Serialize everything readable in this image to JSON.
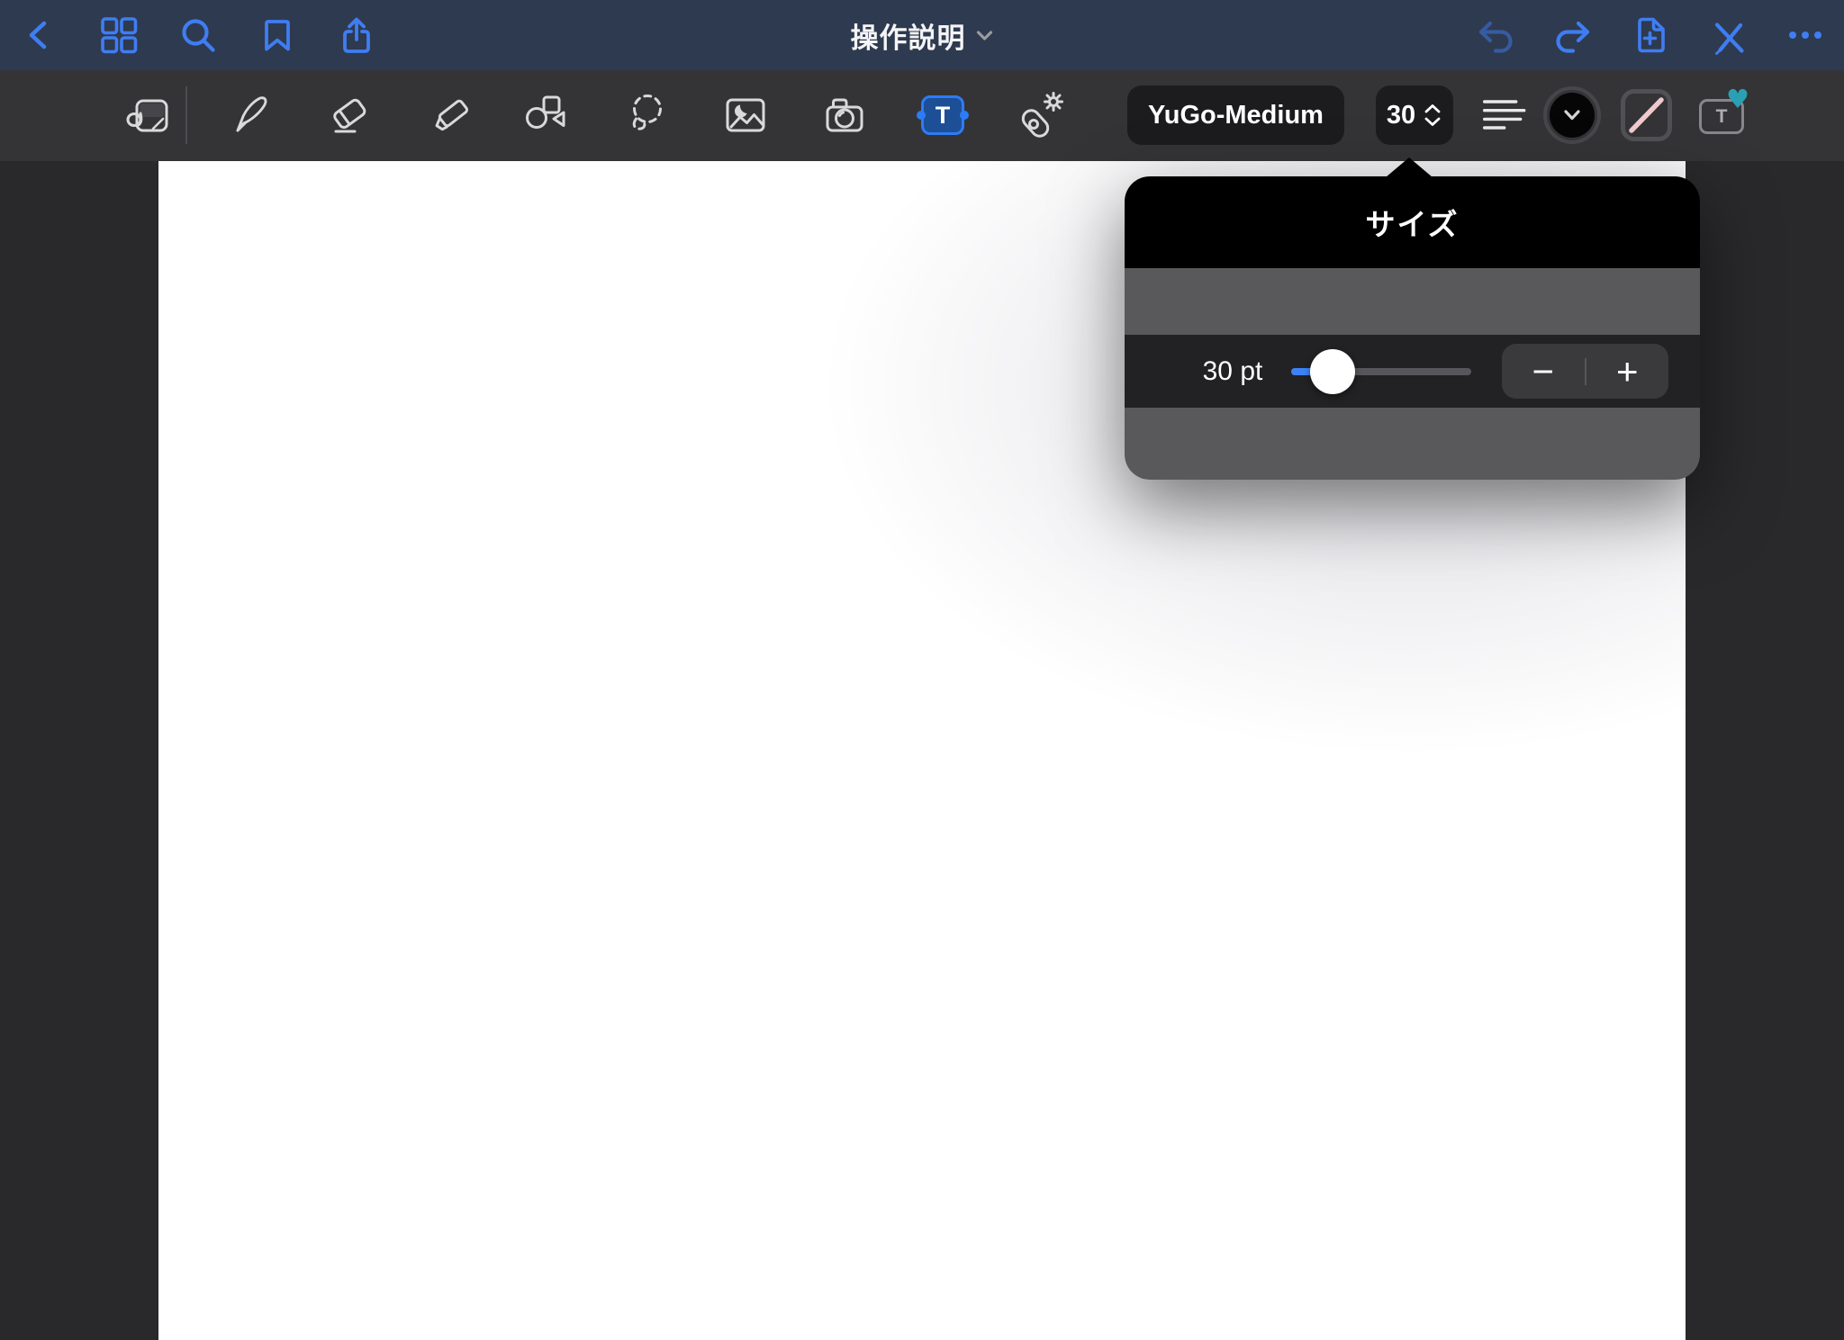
{
  "nav": {
    "title": "操作説明",
    "left_icons": [
      "back-icon",
      "page-thumbnails-icon",
      "search-icon",
      "bookmark-icon",
      "share-icon"
    ],
    "right_icons": [
      "undo-icon",
      "redo-icon",
      "add-page-icon",
      "pen-mode-toggle-icon",
      "more-icon"
    ],
    "undo_enabled": false
  },
  "toolbar": {
    "tools": [
      {
        "name": "document-edit-mode",
        "selected": false
      },
      {
        "name": "pen",
        "selected": false
      },
      {
        "name": "eraser",
        "selected": false
      },
      {
        "name": "highlighter",
        "selected": false
      },
      {
        "name": "shapes",
        "selected": false
      },
      {
        "name": "lasso",
        "selected": false
      },
      {
        "name": "image",
        "selected": false
      },
      {
        "name": "camera",
        "selected": false
      },
      {
        "name": "text",
        "selected": true
      },
      {
        "name": "laser-pointer",
        "selected": false
      }
    ],
    "font_name": "YuGo-Medium",
    "font_size": "30",
    "text_tool_glyph": "T",
    "text_style_glyph": "T",
    "text_style_badge": "♥"
  },
  "popover": {
    "title": "サイズ",
    "size_value_label": "30 pt",
    "slider_value": 30,
    "decrease_label": "−",
    "increase_label": "+"
  },
  "colors": {
    "nav_bar_bg": "#2e3a4f",
    "toolbar_bg": "#343437",
    "canvas_surround_bg": "#29292b",
    "accent_blue": "#3f7df2",
    "selected_tool_border": "#2e7bf6",
    "selected_tool_fill": "#1d4f97",
    "slider_blue": "#3b82f7",
    "stroke_style_pink": "#f0c9cd",
    "favorite_heart_teal": "#2aa0b5",
    "popover_header_bg": "#000000",
    "popover_band_bg": "#59595b",
    "popover_row_bg": "#222224"
  }
}
